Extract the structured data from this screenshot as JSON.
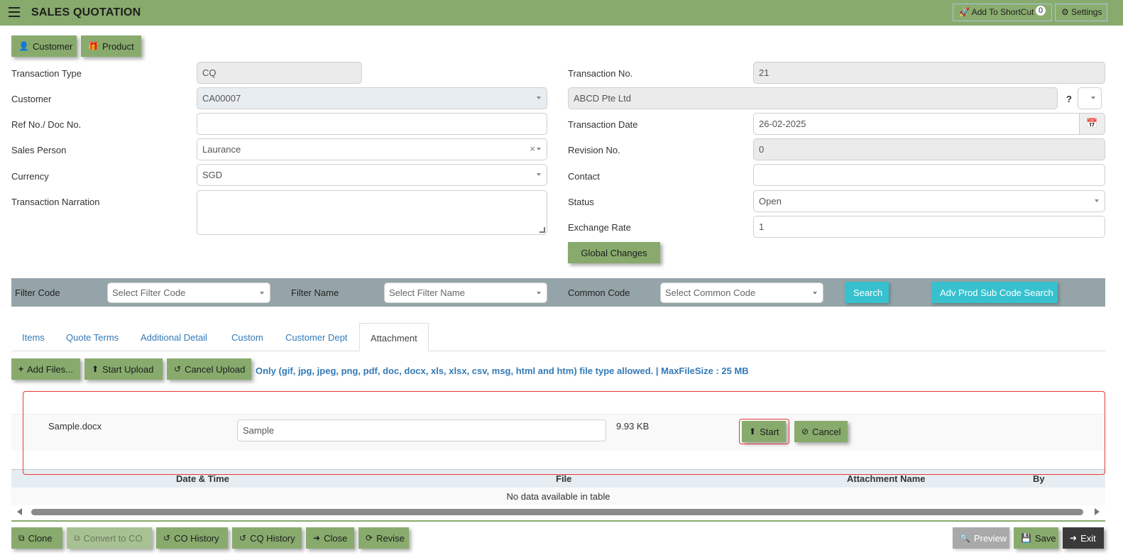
{
  "header": {
    "title": "SALES QUOTATION",
    "add_shortcut_label": "Add To ShortCut",
    "shortcut_count": "0",
    "settings_label": "Settings"
  },
  "top_buttons": {
    "customer": "Customer",
    "product": "Product"
  },
  "form": {
    "transaction_type": {
      "label": "Transaction Type",
      "value": "CQ"
    },
    "customer": {
      "label": "Customer",
      "value": "CA00007",
      "name": "ABCD Pte Ltd",
      "help": "?"
    },
    "ref_no": {
      "label": "Ref No./ Doc No.",
      "value": ""
    },
    "sales_person": {
      "label": "Sales Person",
      "value": "Laurance",
      "clear": "×"
    },
    "currency": {
      "label": "Currency",
      "value": "SGD"
    },
    "narration": {
      "label": "Transaction Narration",
      "value": ""
    },
    "transaction_no": {
      "label": "Transaction No.",
      "value": "21"
    },
    "transaction_date": {
      "label": "Transaction Date",
      "value": "26-02-2025"
    },
    "revision_no": {
      "label": "Revision No.",
      "value": "0"
    },
    "contact": {
      "label": "Contact",
      "value": ""
    },
    "status": {
      "label": "Status",
      "value": "Open"
    },
    "exchange_rate": {
      "label": "Exchange Rate",
      "value": "1"
    },
    "global_changes": "Global Changes"
  },
  "filter": {
    "filter_code_label": "Filter Code",
    "filter_code_placeholder": "Select Filter Code",
    "filter_name_label": "Filter Name",
    "filter_name_placeholder": "Select Filter Name",
    "common_code_label": "Common Code",
    "common_code_placeholder": "Select Common Code",
    "search": "Search",
    "adv_search": "Adv Prod Sub Code Search"
  },
  "tabs": [
    "Items",
    "Quote Terms",
    "Additional Detail",
    "Custom",
    "Customer Dept",
    "Attachment"
  ],
  "attachment": {
    "add_files": "Add Files...",
    "start_upload": "Start Upload",
    "cancel_upload": "Cancel Upload",
    "info": "Only (gif, jpg, jpeg, png, pdf, doc, docx, xls, xlsx, csv, msg, html and htm) file type allowed. | MaxFileSize : 25 MB",
    "file": {
      "name": "Sample.docx",
      "attachment_name": "Sample",
      "size": "9.93 KB",
      "start": "Start",
      "cancel": "Cancel"
    },
    "table": {
      "columns": [
        "Date & Time",
        "File",
        "Attachment Name",
        "By"
      ],
      "empty": "No data available in table"
    }
  },
  "footer": {
    "clone": "Clone",
    "convert_to_co": "Convert to CO",
    "co_history": "CO History",
    "cq_history": "CQ History",
    "close": "Close",
    "revise": "Revise",
    "preview": "Preview",
    "save": "Save",
    "exit": "Exit"
  }
}
